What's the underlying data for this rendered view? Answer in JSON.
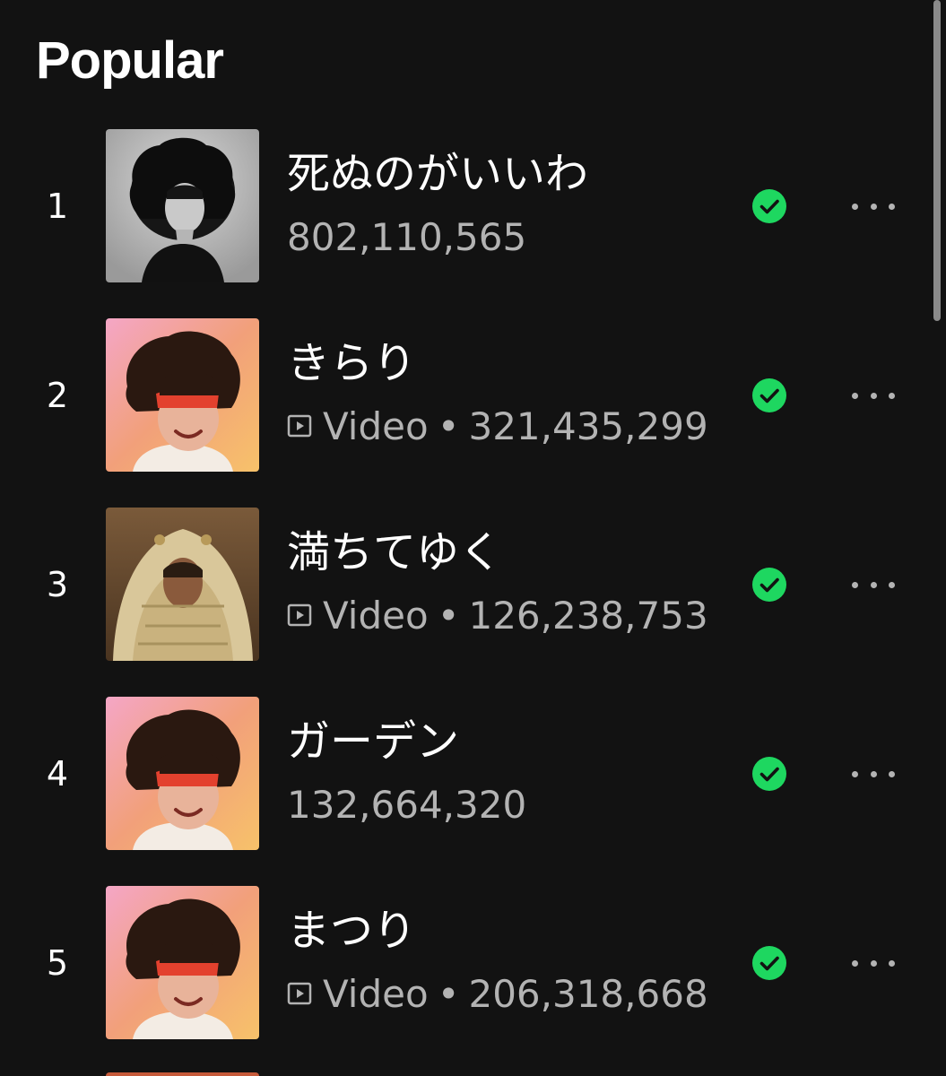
{
  "section": {
    "title": "Popular"
  },
  "tracks": [
    {
      "rank": "1",
      "title": "死ぬのがいいわ",
      "has_video": false,
      "video_label": "",
      "separator": "",
      "plays": "802,110,565",
      "saved": true,
      "cover": "bw-portrait"
    },
    {
      "rank": "2",
      "title": "きらり",
      "has_video": true,
      "video_label": "Video",
      "separator": "•",
      "plays": "321,435,299",
      "saved": true,
      "cover": "warm-gradient-portrait"
    },
    {
      "rank": "3",
      "title": "満ちてゆく",
      "has_video": true,
      "video_label": "Video",
      "separator": "•",
      "plays": "126,238,753",
      "saved": true,
      "cover": "blanket-portrait"
    },
    {
      "rank": "4",
      "title": "ガーデン",
      "has_video": false,
      "video_label": "",
      "separator": "",
      "plays": "132,664,320",
      "saved": true,
      "cover": "warm-gradient-portrait"
    },
    {
      "rank": "5",
      "title": "まつり",
      "has_video": true,
      "video_label": "Video",
      "separator": "•",
      "plays": "206,318,668",
      "saved": true,
      "cover": "warm-gradient-portrait"
    }
  ],
  "colors": {
    "background": "#121212",
    "primary_text": "#ffffff",
    "secondary_text": "#b3b3b3",
    "saved_green": "#1ed760"
  },
  "icons": {
    "video": "video-play-icon",
    "saved": "check-circle-icon",
    "more": "more-horizontal-icon"
  }
}
